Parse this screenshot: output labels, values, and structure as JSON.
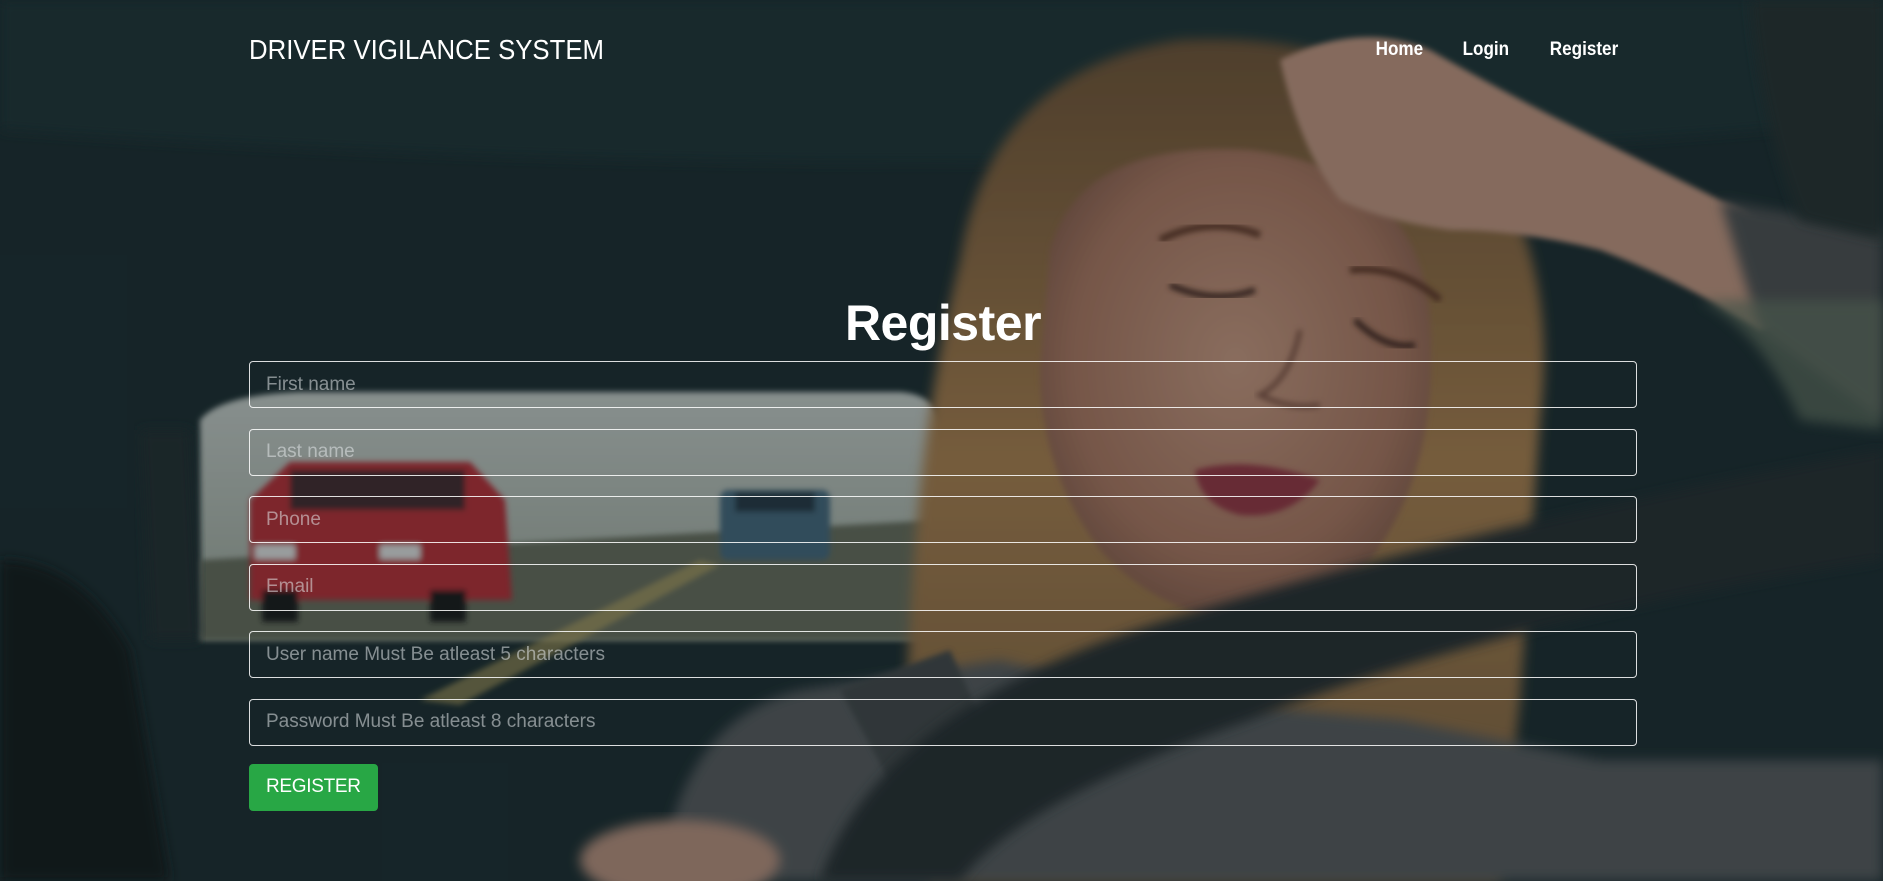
{
  "navbar": {
    "brand": "DRIVER VIGILANCE SYSTEM",
    "links": [
      "Home",
      "Login",
      "Register"
    ]
  },
  "form": {
    "title": "Register",
    "fields": [
      {
        "name": "first-name",
        "placeholder": "First name",
        "value": ""
      },
      {
        "name": "last-name",
        "placeholder": "Last name",
        "value": ""
      },
      {
        "name": "phone",
        "placeholder": "Phone",
        "value": ""
      },
      {
        "name": "email",
        "placeholder": "Email",
        "value": ""
      },
      {
        "name": "username",
        "placeholder": "User name Must Be atleast 5 characters",
        "value": ""
      },
      {
        "name": "password",
        "placeholder": "Password Must Be atleast 8 characters",
        "value": ""
      }
    ],
    "submit_label": "REGISTER"
  },
  "colors": {
    "primary_button": "#28a745",
    "text": "#ffffff",
    "field_border": "#ffffff"
  },
  "background": {
    "description_icon": "drowsy-driver-photo"
  }
}
